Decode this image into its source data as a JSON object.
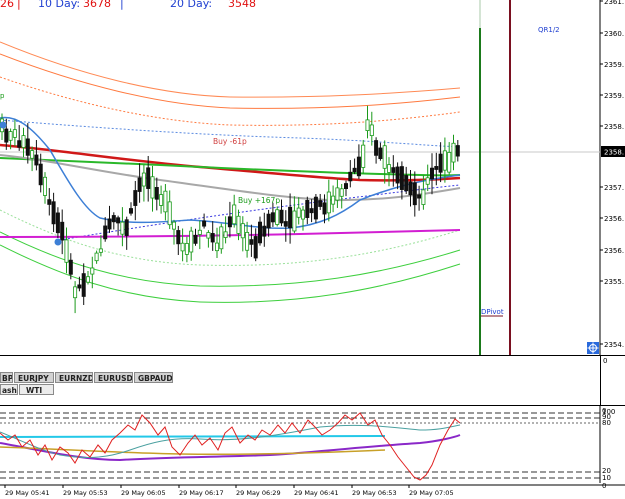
{
  "header": {
    "partial_value": "26",
    "sep1": "|",
    "ten_day_label": "10 Day:",
    "ten_day_value": "3678",
    "sep2": "|",
    "twenty_day_label": "20 Day:",
    "twenty_day_value": "3548"
  },
  "price_axis": {
    "labels": [
      "2361.",
      "2360.",
      "2359.",
      "2359.",
      "2358.",
      "2357.",
      "2356.",
      "2356.",
      "2355.",
      "2354."
    ],
    "current_price": "2358."
  },
  "annotations": {
    "qr_label": "QR1/2",
    "buy_top": "Buy -61p",
    "buy_mid": "Buy +167p",
    "pivot_label": "DPivot"
  },
  "tabs": {
    "row1": [
      "BP",
      "EURJPY",
      "EURNZD",
      "EURUSD",
      "GBPAUD"
    ],
    "row2": [
      "ash",
      "WTI"
    ]
  },
  "oscillator": {
    "level_labels": [
      "100",
      "90",
      "80",
      "20",
      "10",
      "0"
    ],
    "top_axis_label": "0"
  },
  "time_axis": [
    "29 May 05:41",
    "29 May 05:53",
    "29 May 06:05",
    "29 May 06:17",
    "29 May 06:29",
    "29 May 06:41",
    "29 May 06:53",
    "29 May 07:05"
  ],
  "colors": {
    "bull_candle": "#1a9a1a",
    "bear_candle": "#111111",
    "header_red": "#e01010",
    "band_orange": "#ff7a40",
    "band_green": "#3ecf3e",
    "ma_red": "#d01818",
    "ma_green": "#2ab82a",
    "ma_gray": "#a8a8a8",
    "ma_blue": "#3d7fd6",
    "ma_magenta": "#d21ed2",
    "pivot_green_line": "#1b7a1b",
    "pivot_maroon_line": "#7a1020",
    "osc_cyan": "#22c8e8",
    "osc_purple": "#8a28c8",
    "osc_gold": "#c8a028",
    "osc_red": "#e02020"
  }
}
